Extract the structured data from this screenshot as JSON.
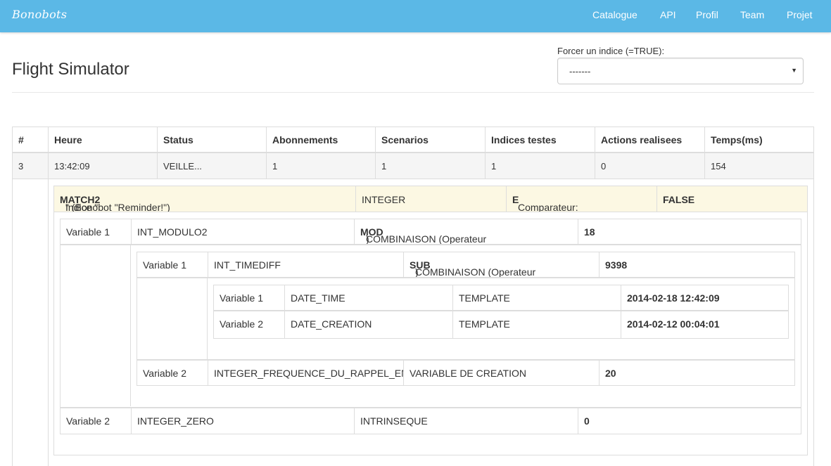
{
  "navbar": {
    "brand": "Bonobots",
    "links": [
      "Catalogue",
      "API",
      "Profil",
      "Team",
      "Projet"
    ]
  },
  "header": {
    "title": "Flight Simulator",
    "force_label": "Forcer un indice (=TRUE):",
    "force_value": "-------"
  },
  "table": {
    "columns": [
      "#",
      "Heure",
      "Status",
      "Abonnements",
      "Scenarios",
      "Indices testes",
      "Actions realisees",
      "Temps(ms)"
    ],
    "row": [
      "3",
      "13:42:09",
      "VEILLE...",
      "1",
      "1",
      "1",
      "0",
      "154"
    ]
  },
  "indice": {
    "prefix": "Indice \"",
    "name": "MATCH2",
    "suffix": "\" (Bonobot \"Reminder!\")",
    "type": "INTEGER",
    "comparateur_label": "Comparateur: ",
    "comparateur": "E",
    "result": "FALSE"
  },
  "tree": {
    "v1": {
      "label": "Variable 1",
      "name": "INT_MODULO2",
      "kind_prefix": "COMBINAISON (Operateur ",
      "op": "MOD",
      "kind_suffix": ")",
      "value": "18"
    },
    "v1_1": {
      "label": "Variable 1",
      "name": "INT_TIMEDIFF",
      "kind_prefix": "COMBINAISON (Operateur ",
      "op": "SUB",
      "kind_suffix": ")",
      "value": "9398"
    },
    "v1_1_1": {
      "label": "Variable 1",
      "name": "DATE_TIME",
      "kind": "TEMPLATE",
      "value": "2014-02-18 12:42:09"
    },
    "v1_1_2": {
      "label": "Variable 2",
      "name": "DATE_CREATION",
      "kind": "TEMPLATE",
      "value": "2014-02-12 00:04:01"
    },
    "v1_2": {
      "label": "Variable 2",
      "name": "INTEGER_FREQUENCE_DU_RAPPEL_EN_MINUTES",
      "kind": "VARIABLE DE CREATION",
      "value": "20"
    },
    "v2": {
      "label": "Variable 2",
      "name": "INTEGER_ZERO",
      "kind": "INTRINSEQUE",
      "value": "0"
    }
  }
}
